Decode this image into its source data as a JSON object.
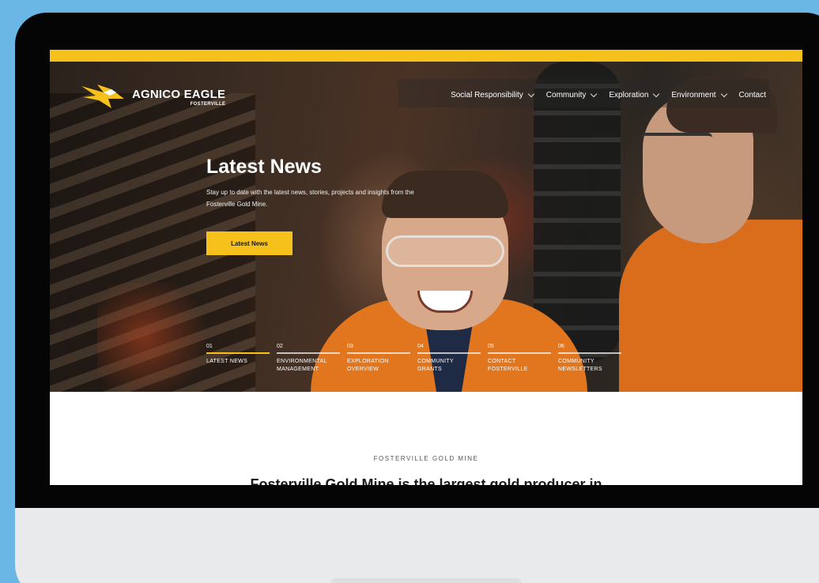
{
  "brand": {
    "name": "AGNICO EAGLE",
    "sub": "FOSTERVILLE",
    "accent": "#f5c11a"
  },
  "nav": {
    "items": [
      {
        "label": "Social Responsibility",
        "dropdown": true
      },
      {
        "label": "Community",
        "dropdown": true
      },
      {
        "label": "Exploration",
        "dropdown": true
      },
      {
        "label": "Environment",
        "dropdown": true
      },
      {
        "label": "Contact",
        "dropdown": false
      }
    ]
  },
  "hero": {
    "title": "Latest News",
    "text": "Stay up to date with the latest news, stories, projects and insights from the Fosterville Gold Mine.",
    "button": "Latest News",
    "steps": [
      {
        "num": "01",
        "label": "LATEST NEWS",
        "active": true
      },
      {
        "num": "02",
        "label": "ENVIRONMENTAL MANAGEMENT",
        "active": false
      },
      {
        "num": "03",
        "label": "EXPLORATION OVERVIEW",
        "active": false
      },
      {
        "num": "04",
        "label": "COMMUNITY GRANTS",
        "active": false
      },
      {
        "num": "05",
        "label": "CONTACT FOSTERVILLE",
        "active": false
      },
      {
        "num": "06",
        "label": "COMMUNITY NEWSLETTERS",
        "active": false
      }
    ]
  },
  "content": {
    "eyebrow": "FOSTERVILLE GOLD MINE",
    "headline": "Fosterville Gold Mine is the largest gold producer in"
  }
}
